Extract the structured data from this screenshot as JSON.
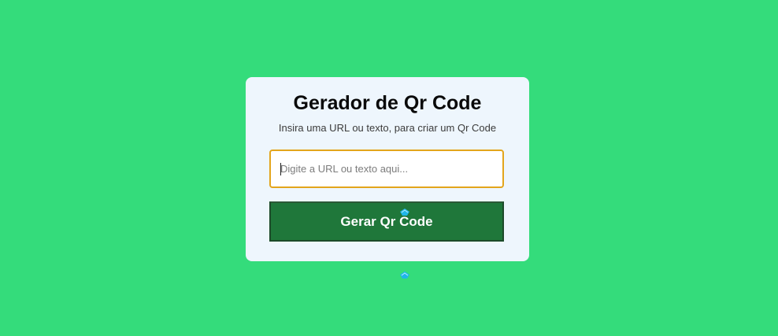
{
  "app": {
    "title": "Gerador de Qr Code",
    "subtitle": "Insira uma URL ou texto, para criar um Qr Code"
  },
  "form": {
    "input_value": "",
    "input_placeholder": "Digite a URL ou texto aqui...",
    "generate_label": "Gerar Qr Code"
  },
  "colors": {
    "background": "#34dc7b",
    "card": "#eef6fd",
    "input_border": "#e3a51c",
    "button": "#1f773a",
    "cursor_marker": "#1fb6e8"
  },
  "icons": {
    "pointer_marker": "cursor-marker-icon"
  }
}
